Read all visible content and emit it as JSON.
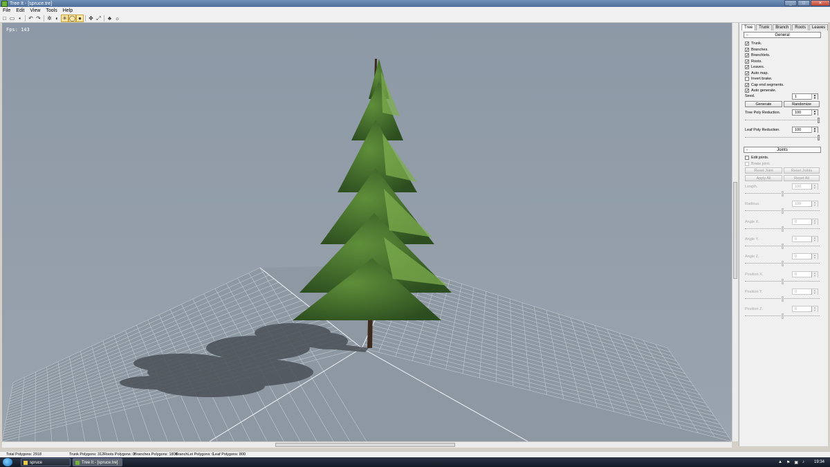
{
  "window": {
    "title": "Tree It - [spruce.tre]",
    "controls": [
      "_",
      "□",
      "✕"
    ]
  },
  "menu": [
    "File",
    "Edit",
    "View",
    "Tools",
    "Help"
  ],
  "toolbar": {
    "icons": [
      "new-icon",
      "open-icon",
      "save-icon",
      "sep",
      "undo-icon",
      "redo-icon",
      "sep",
      "gear-icon",
      "leaf-icon",
      "star-icon",
      "bulb-icon",
      "record-icon",
      "sep",
      "move-icon",
      "zoom-icon",
      "sep",
      "tree-icon",
      "sun-icon"
    ],
    "glyphs": {
      "new-icon": "□",
      "open-icon": "▭",
      "save-icon": "▪",
      "undo-icon": "↶",
      "redo-icon": "↷",
      "gear-icon": "✲",
      "leaf-icon": "◐",
      "star-icon": "✳",
      "bulb-icon": "◯",
      "record-icon": "●",
      "move-icon": "✥",
      "zoom-icon": "⤢",
      "tree-icon": "♣",
      "sun-icon": "☼"
    },
    "active": [
      "star-icon",
      "bulb-icon",
      "record-icon"
    ]
  },
  "viewport": {
    "fps": "Fps: 143",
    "background": "#8d99a6"
  },
  "panel": {
    "tabs": [
      "Tree",
      "Trunk",
      "Branch",
      "Roots",
      "Leaves"
    ],
    "active_tab": "Tree",
    "general": {
      "header": "General",
      "options": [
        {
          "label": "Trunk.",
          "checked": true
        },
        {
          "label": "Branches.",
          "checked": true
        },
        {
          "label": "Branchlets.",
          "checked": true
        },
        {
          "label": "Roots.",
          "checked": true
        },
        {
          "label": "Leaves.",
          "checked": true
        },
        {
          "label": "Auto map.",
          "checked": true
        },
        {
          "label": "Invert brake.",
          "checked": false
        },
        {
          "label": "Cap end segments.",
          "checked": true
        },
        {
          "label": "Auto generate.",
          "checked": true
        }
      ],
      "seed_label": "Seed.",
      "seed_value": "1",
      "generate": "Generate",
      "randomize": "Randomize",
      "tree_poly_label": "Tree Poly Reduction.",
      "tree_poly_value": "100",
      "tree_poly_level": 1.0,
      "leaf_poly_label": "Leaf Poly Reduction.",
      "leaf_poly_value": "100",
      "leaf_poly_level": 1.0
    },
    "joints": {
      "header": "Joints",
      "options": [
        {
          "label": "Edit joints.",
          "checked": false,
          "disabled": false
        },
        {
          "label": "Brake joint.",
          "checked": false,
          "disabled": true
        }
      ],
      "reset_joint": "Reset Joint",
      "reset_joints": "Reset Joints",
      "apply_all": "Apply All",
      "reset_all": "Reset All",
      "fields": [
        {
          "label": "Length.",
          "value": "100",
          "level": 0.5
        },
        {
          "label": "Radious.",
          "value": "100",
          "level": 0.5
        },
        {
          "label": "Angle X.",
          "value": "0",
          "level": 0.5
        },
        {
          "label": "Angle Y.",
          "value": "0",
          "level": 0.5
        },
        {
          "label": "Angle Z.",
          "value": "0",
          "level": 0.5
        },
        {
          "label": "Position X.",
          "value": "0",
          "level": 0.5
        },
        {
          "label": "Position Y.",
          "value": "0",
          "level": 0.5
        },
        {
          "label": "Position Z.",
          "value": "0",
          "level": 0.5
        }
      ]
    }
  },
  "status": {
    "total": "Total Polygons: 2918",
    "trunk": "Trunk Polygons: 312",
    "roots": "Roots Polygons: 0",
    "branches": "Branches Polygons: 1806",
    "branchlet": "BranchLet Polygons: 0",
    "leaf": "Leaf Polygons: 800"
  },
  "taskbar": {
    "items": [
      {
        "label": "spruce",
        "active": false
      },
      {
        "label": "Tree It - [spruce.tre]",
        "active": true
      }
    ],
    "clock": "19:34"
  }
}
